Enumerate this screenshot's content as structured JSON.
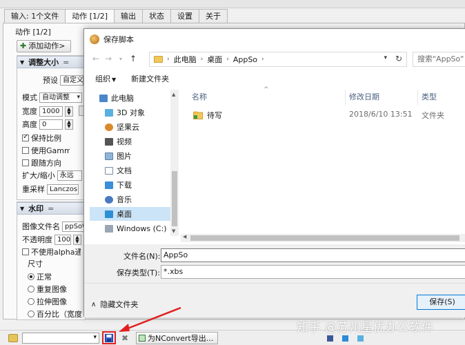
{
  "app": {
    "tabs": [
      "输入: 1个文件",
      "动作 [1/2]",
      "输出",
      "状态",
      "设置",
      "关于"
    ],
    "actions_label": "动作 [1/2]",
    "add_action_label": "添加动作>",
    "resize": {
      "header": "调整大小",
      "preset_label": "预设",
      "preset_value": "自定义",
      "mode_label": "模式",
      "mode_value": "自动调整",
      "width_label": "宽度",
      "width_value": "1000",
      "height_label": "高度",
      "height_value": "0",
      "keep_ratio_label": "保持比例",
      "use_gamma_label": "使用Gamma纠正",
      "follow_direction_label": "跟随方向",
      "scale_label": "扩大/缩小",
      "scale_value": "永远",
      "resample_label": "重采样",
      "resample_value": "Lanczos"
    },
    "watermark": {
      "header": "水印",
      "image_file_label": "图像文件名",
      "image_file_value": "ppSo\\",
      "opacity_label": "不透明度",
      "opacity_value": "100",
      "no_alpha_label": "不使用alpha通",
      "size_label": "尺寸",
      "radio_normal": "正常",
      "radio_repeat": "重复图像",
      "radio_stretch": "拉伸图像",
      "radio_percent": "百分比（宽度"
    },
    "bottom": {
      "export_label": "为NConvert导出..."
    }
  },
  "dialog": {
    "title": "保存脚本",
    "breadcrumb": [
      "此电脑",
      "桌面",
      "AppSo"
    ],
    "search_placeholder": "搜索\"AppSo\"",
    "organize_label": "组织",
    "new_folder_label": "新建文件夹",
    "nav_items": [
      {
        "label": "此电脑"
      },
      {
        "label": "3D 对象"
      },
      {
        "label": "坚果云"
      },
      {
        "label": "视频"
      },
      {
        "label": "图片"
      },
      {
        "label": "文档"
      },
      {
        "label": "下载"
      },
      {
        "label": "音乐"
      },
      {
        "label": "桌面"
      },
      {
        "label": "Windows (C:)"
      }
    ],
    "columns": {
      "name": "名称",
      "date": "修改日期",
      "type": "类型"
    },
    "files": [
      {
        "name": "待写",
        "date": "2018/6/10 13:51",
        "type": "文件夹"
      }
    ],
    "filename_label": "文件名(N):",
    "filename_value": "AppSo",
    "filetype_label": "保存类型(T):",
    "filetype_value": "*.xbs",
    "hide_folders_label": "隐藏文件夹",
    "save_label": "保存(S)"
  },
  "watermark_text": "知乎 @苏州星优办公软件",
  "colors": {
    "accent": "#0078d7",
    "highlight": "#e02020",
    "selection": "#cce4f7"
  }
}
